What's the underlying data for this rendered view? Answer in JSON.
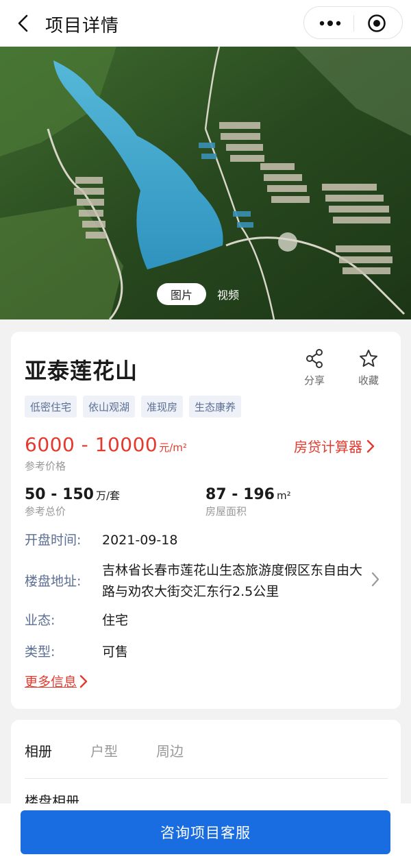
{
  "nav": {
    "title": "项目详情"
  },
  "hero": {
    "media_tabs": [
      {
        "label": "图片",
        "active": true
      },
      {
        "label": "视频",
        "active": false
      }
    ]
  },
  "project": {
    "name": "亚泰莲花山",
    "actions": {
      "share_label": "分享",
      "favorite_label": "收藏"
    },
    "tags": [
      "低密住宅",
      "依山观湖",
      "准现房",
      "生态康养"
    ],
    "price": {
      "value": "6000 - 10000",
      "unit": "元/m²",
      "label": "参考价格"
    },
    "calculator_label": "房贷计算器",
    "total_price": {
      "value": "50 - 150",
      "unit": "万/套",
      "label": "参考总价"
    },
    "area": {
      "value": "87 - 196",
      "unit": "m²",
      "label": "房屋面积"
    },
    "details": {
      "opening_key": "开盘时间:",
      "opening_value": "2021-09-18",
      "address_key": "楼盘地址:",
      "address_value": "吉林省长春市莲花山生态旅游度假区东自由大路与劝农大街交汇东行2.5公里",
      "usage_key": "业态:",
      "usage_value": "住宅",
      "type_key": "类型:",
      "type_value": "可售"
    },
    "more_info_label": "更多信息"
  },
  "tabs": {
    "items": [
      "相册",
      "户型",
      "周边"
    ],
    "active_index": 0,
    "section_title": "楼盘相册"
  },
  "footer": {
    "consult_button": "咨询项目客服"
  },
  "colors": {
    "accent_red": "#e4392c",
    "primary_blue": "#1a6de0",
    "tag_text": "#5b6e93",
    "tag_bg": "#eef2f8"
  }
}
